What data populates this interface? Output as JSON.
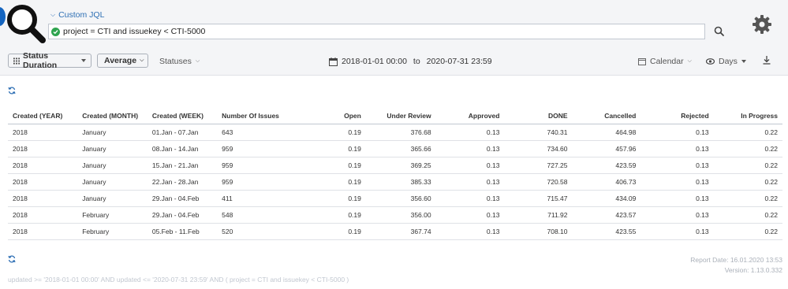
{
  "header": {
    "jql_toggle_label": "Custom JQL",
    "jql_query": "project = CTI and issuekey < CTI-5000"
  },
  "toolbar": {
    "report_type": "Status Duration",
    "aggregation": "Average",
    "statuses_label": "Statuses",
    "date_from": "2018-01-01 00:00",
    "date_to_label": "to",
    "date_to": "2020-07-31 23:59",
    "calendar_label": "Calendar",
    "days_label": "Days"
  },
  "table": {
    "headers": [
      "Created (YEAR)",
      "Created (MONTH)",
      "Created (WEEK)",
      "Number Of Issues",
      "Open",
      "Under Review",
      "Approved",
      "DONE",
      "Cancelled",
      "Rejected",
      "In Progress"
    ],
    "rows": [
      [
        "2018",
        "January",
        "01.Jan - 07.Jan",
        "643",
        "0.19",
        "376.68",
        "0.13",
        "740.31",
        "464.98",
        "0.13",
        "0.22"
      ],
      [
        "2018",
        "January",
        "08.Jan - 14.Jan",
        "959",
        "0.19",
        "365.66",
        "0.13",
        "734.60",
        "457.96",
        "0.13",
        "0.22"
      ],
      [
        "2018",
        "January",
        "15.Jan - 21.Jan",
        "959",
        "0.19",
        "369.25",
        "0.13",
        "727.25",
        "423.59",
        "0.13",
        "0.22"
      ],
      [
        "2018",
        "January",
        "22.Jan - 28.Jan",
        "959",
        "0.19",
        "385.33",
        "0.13",
        "720.58",
        "406.73",
        "0.13",
        "0.22"
      ],
      [
        "2018",
        "January",
        "29.Jan - 04.Feb",
        "411",
        "0.19",
        "356.60",
        "0.13",
        "715.47",
        "434.09",
        "0.13",
        "0.22"
      ],
      [
        "2018",
        "February",
        "29.Jan - 04.Feb",
        "548",
        "0.19",
        "356.00",
        "0.13",
        "711.92",
        "423.57",
        "0.13",
        "0.22"
      ],
      [
        "2018",
        "February",
        "05.Feb - 11.Feb",
        "520",
        "0.19",
        "367.74",
        "0.13",
        "708.10",
        "423.55",
        "0.13",
        "0.22"
      ]
    ]
  },
  "footer": {
    "report_date": "Report Date: 16.01.2020 13:53",
    "version": "Version: 1.13.0.332",
    "query": "updated >= '2018-01-01 00:00' AND updated <= '2020-07-31 23:59' AND ( project = CTI and issuekey < CTI-5000 )"
  },
  "colors": {
    "link": "#2e6fb4",
    "valid_check": "#2ea44f",
    "brand_dot": "#1565c0"
  },
  "icons": [
    "magnifier-logo-icon",
    "chevron-down-icon",
    "check-circle-icon",
    "search-icon",
    "gear-icon",
    "grid-icon",
    "calendar-icon",
    "eye-icon",
    "download-icon",
    "refresh-icon"
  ]
}
